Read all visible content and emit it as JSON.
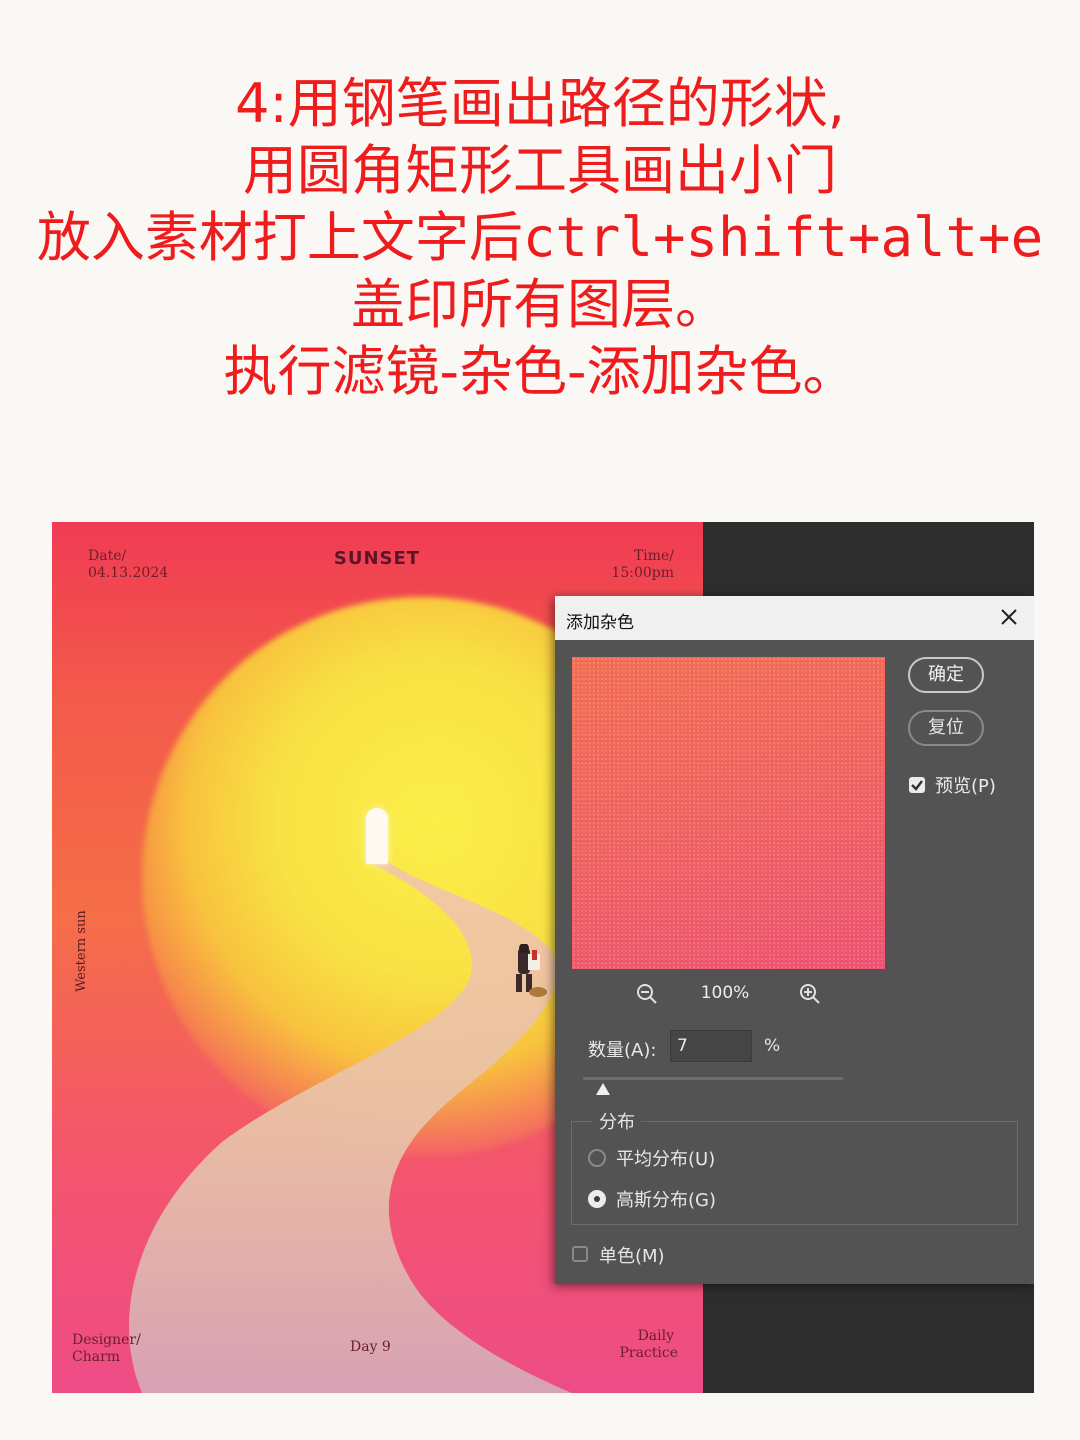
{
  "instructions": {
    "line1": "4:用钢笔画出路径的形状,",
    "line2": "用圆角矩形工具画出小门",
    "line3_cjk": "放入素材打上文字后",
    "line3_code": "ctrl+shift+alt+e",
    "line4": "盖印所有图层。",
    "line5": "执行滤镜-杂色-添加杂色。"
  },
  "poster": {
    "title": "SUNSET",
    "date_label": "Date/",
    "date_value": "04.13.2024",
    "time_label": "Time/",
    "time_value": "15:00pm",
    "side_text": "Western sun",
    "designer_label": "Designer/",
    "designer_value": "Charm",
    "day": "Day 9",
    "daily_line1": "Daily",
    "daily_line2": "Practice",
    "colors": {
      "sun": "#fbee48",
      "top": "#f03b54",
      "bottom": "#ee4c86",
      "road": "#e8c3a8"
    }
  },
  "dialog": {
    "title": "添加杂色",
    "ok_label": "确定",
    "reset_label": "复位",
    "preview_label": "预览(P)",
    "preview_checked": true,
    "zoom_level": "100%",
    "amount_label": "数量(A):",
    "amount_value": "7",
    "amount_unit": "%",
    "distribution_title": "分布",
    "uniform_label": "平均分布(U)",
    "gaussian_label": "高斯分布(G)",
    "selected_distribution": "gaussian",
    "monochromatic_label": "单色(M)",
    "monochromatic_checked": false,
    "icons": [
      "close-icon",
      "zoom-out-icon",
      "zoom-in-icon",
      "checkmark-icon",
      "slider-thumb-icon"
    ]
  }
}
